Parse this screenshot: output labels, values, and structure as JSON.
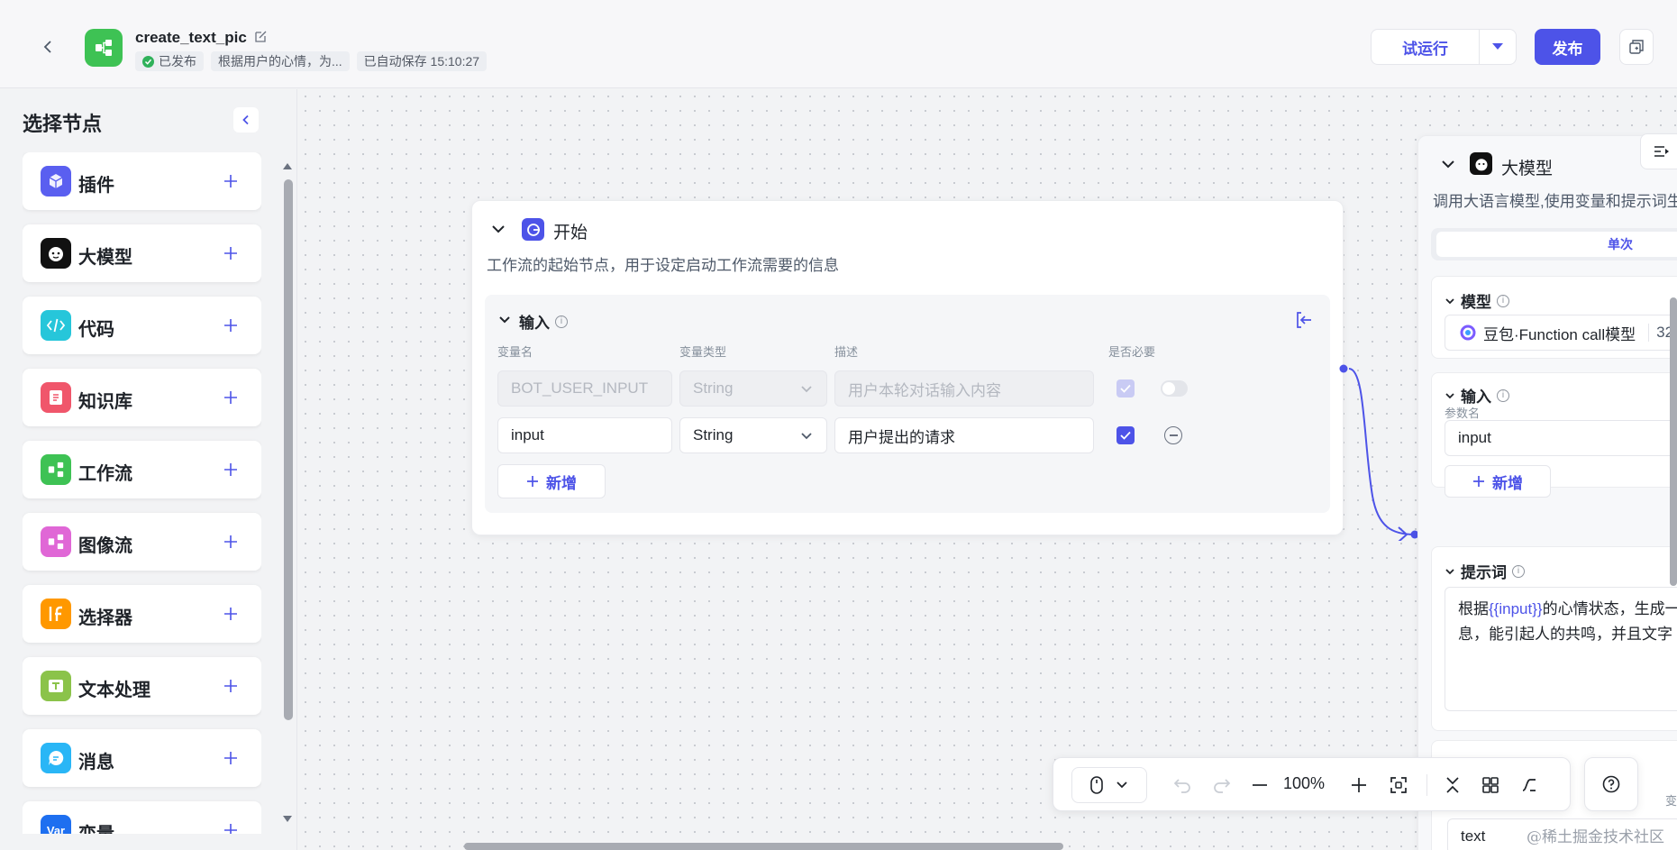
{
  "header": {
    "app_name": "create_text_pic",
    "status": "已发布",
    "description": "根据用户的心情，为...",
    "autosave": "已自动保存 15:10:27",
    "trial_run": "试运行",
    "publish": "发布",
    "colors": {
      "accent": "#4d53e8",
      "logo": "#3ec254",
      "published": "#2fb15a"
    }
  },
  "sidebar": {
    "title": "选择节点",
    "items": [
      {
        "label": "插件",
        "icon": "plugin-icon",
        "color": "#5a5ff0"
      },
      {
        "label": "大模型",
        "icon": "llm-icon",
        "color": "#111111"
      },
      {
        "label": "代码",
        "icon": "code-icon",
        "color": "#26c6da"
      },
      {
        "label": "知识库",
        "icon": "knowledge-icon",
        "color": "#f0566b"
      },
      {
        "label": "工作流",
        "icon": "workflow-icon",
        "color": "#3ec254"
      },
      {
        "label": "图像流",
        "icon": "imageflow-icon",
        "color": "#e067d6"
      },
      {
        "label": "选择器",
        "icon": "selector-icon",
        "color": "#ff9800"
      },
      {
        "label": "文本处理",
        "icon": "text-process-icon",
        "color": "#8bc34a"
      },
      {
        "label": "消息",
        "icon": "message-icon",
        "color": "#29b6f6"
      },
      {
        "label": "变量",
        "icon": "variable-icon",
        "color": "#1e6ff0",
        "icon_text": "Var"
      }
    ]
  },
  "start_node": {
    "title": "开始",
    "description": "工作流的起始节点，用于设定启动工作流需要的信息",
    "input_section": {
      "title": "输入",
      "columns": [
        "变量名",
        "变量类型",
        "描述",
        "是否必要"
      ],
      "rows": [
        {
          "name": "BOT_USER_INPUT",
          "type": "String",
          "desc_placeholder": "用户本轮对话输入内容",
          "required": true,
          "disabled": true
        },
        {
          "name": "input",
          "type": "String",
          "desc": "用户提出的请求",
          "required": true,
          "disabled": false
        }
      ],
      "add_label": "新增"
    }
  },
  "llm_node": {
    "title": "大模型",
    "description": "调用大语言模型,使用变量和提示词生成回复",
    "mode": "单次",
    "model_section": {
      "title": "模型",
      "model_name": "豆包·Function call模型",
      "extra": "32"
    },
    "input_section": {
      "title": "输入",
      "param_label": "参数名",
      "param_value": "input",
      "add_label": "新增"
    },
    "prompt_section": {
      "title": "提示词",
      "line1_pre": "根据",
      "line1_var": "{{input}}",
      "line1_post": "的心情状态，生成一",
      "line2": "息，能引起人的共鸣，并且文字"
    },
    "output_label": "变",
    "output_value": "text"
  },
  "toolbar": {
    "zoom": "100%"
  },
  "watermark": "@稀土掘金技术社区"
}
